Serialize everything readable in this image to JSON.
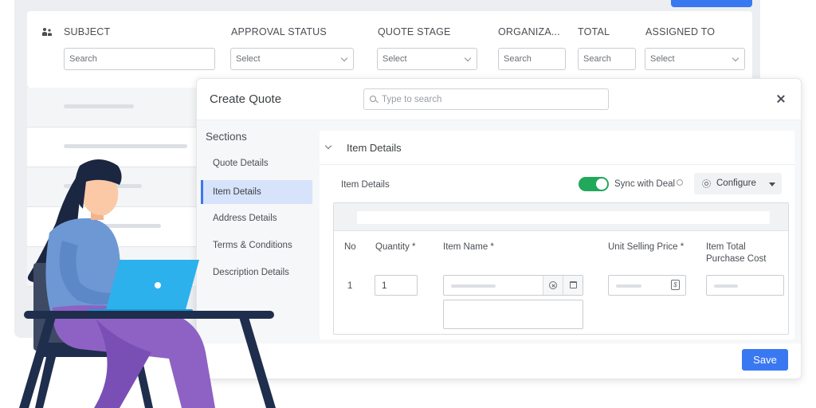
{
  "list_view": {
    "columns": [
      {
        "label": "SUBJECT",
        "filter": "Search",
        "filter_type": "text"
      },
      {
        "label": "APPROVAL STATUS",
        "filter": "Select",
        "filter_type": "select"
      },
      {
        "label": "QUOTE STAGE",
        "filter": "Select",
        "filter_type": "select"
      },
      {
        "label": "ORGANIZA...",
        "filter": "Search",
        "filter_type": "text"
      },
      {
        "label": "TOTAL",
        "filter": "Search",
        "filter_type": "text"
      },
      {
        "label": "ASSIGNED TO",
        "filter": "Select",
        "filter_type": "select"
      }
    ]
  },
  "modal": {
    "title": "Create Quote",
    "search_placeholder": "Type to search",
    "sections_title": "Sections",
    "sections": [
      {
        "label": "Quote Details",
        "active": false
      },
      {
        "label": "Item Details",
        "active": true
      },
      {
        "label": "Address Details",
        "active": false
      },
      {
        "label": "Terms & Conditions",
        "active": false
      },
      {
        "label": "Description Details",
        "active": false
      }
    ],
    "content_title": "Item Details",
    "sub_label": "Item Details",
    "sync_label": "Sync with Deal",
    "sync_enabled": true,
    "configure_label": "Configure",
    "table": {
      "headers": {
        "no": "No",
        "quantity": "Quantity *",
        "item_name": "Item Name *",
        "unit_price": "Unit Selling Price *",
        "total_cost_line1": "Item Total",
        "total_cost_line2": "Purchase Cost"
      },
      "row": {
        "no": "1",
        "quantity": "1"
      }
    },
    "save_label": "Save"
  },
  "colors": {
    "accent": "#3a78f2",
    "toggle_on": "#22a85a",
    "active_section_bg": "#d6e3fb",
    "illustration_hair": "#1b2640",
    "illustration_skin": "#fbc9a6",
    "illustration_top": "#6d98d4",
    "illustration_pants": "#8e62c4",
    "illustration_laptop": "#2cb1ec",
    "illustration_table": "#1f2e4d"
  }
}
